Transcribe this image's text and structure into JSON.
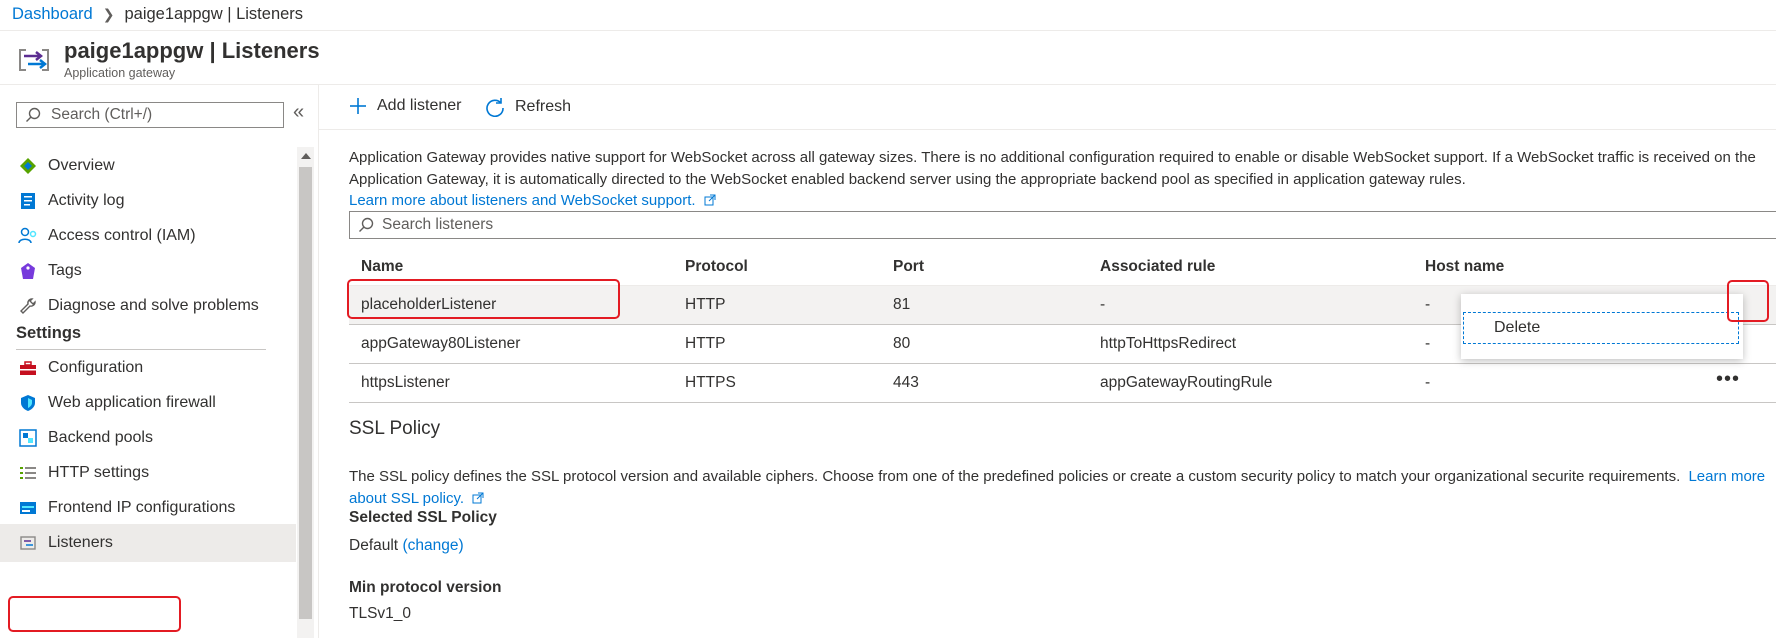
{
  "breadcrumb": {
    "root": "Dashboard",
    "current": "paige1appgw | Listeners"
  },
  "header": {
    "title": "paige1appgw | Listeners",
    "subtitle": "Application gateway"
  },
  "sidebar": {
    "search_placeholder": "Search (Ctrl+/)",
    "items": [
      {
        "label": "Overview",
        "icon": "overview-icon"
      },
      {
        "label": "Activity log",
        "icon": "activity-log-icon"
      },
      {
        "label": "Access control (IAM)",
        "icon": "iam-icon"
      },
      {
        "label": "Tags",
        "icon": "tag-icon"
      },
      {
        "label": "Diagnose and solve problems",
        "icon": "wrench-icon"
      }
    ],
    "settings_title": "Settings",
    "settings_items": [
      {
        "label": "Configuration",
        "icon": "toolbox-icon"
      },
      {
        "label": "Web application firewall",
        "icon": "shield-icon"
      },
      {
        "label": "Backend pools",
        "icon": "backend-pools-icon"
      },
      {
        "label": "HTTP settings",
        "icon": "list-settings-icon"
      },
      {
        "label": "Frontend IP configurations",
        "icon": "frontend-ip-icon"
      },
      {
        "label": "Listeners",
        "icon": "listener-icon",
        "active": true
      }
    ]
  },
  "toolbar": {
    "add_label": "Add listener",
    "refresh_label": "Refresh"
  },
  "info": {
    "text": "Application Gateway provides native support for WebSocket across all gateway sizes. There is no additional configuration required to enable or disable WebSocket support. If a WebSocket traffic is received on the Application Gateway, it is automatically directed to the WebSocket enabled backend server using the appropriate backend pool as specified in application gateway rules.",
    "link": "Learn more about listeners and WebSocket support."
  },
  "listeners": {
    "search_placeholder": "Search listeners",
    "columns": [
      "Name",
      "Protocol",
      "Port",
      "Associated rule",
      "Host name"
    ],
    "rows": [
      {
        "name": "placeholderListener",
        "protocol": "HTTP",
        "port": "81",
        "rule": "-",
        "host": "-"
      },
      {
        "name": "appGateway80Listener",
        "protocol": "HTTP",
        "port": "80",
        "rule": "httpToHttpsRedirect",
        "host": "-"
      },
      {
        "name": "httpsListener",
        "protocol": "HTTPS",
        "port": "443",
        "rule": "appGatewayRoutingRule",
        "host": "-"
      }
    ],
    "more_label": "•••"
  },
  "context_menu": {
    "delete_label": "Delete"
  },
  "ssl": {
    "title": "SSL Policy",
    "desc": "The SSL policy defines the SSL protocol version and available ciphers. Choose from one of the predefined policies or create a custom security policy to match your organizational securite requirements.",
    "link": "Learn more about SSL policy.",
    "selected_label": "Selected SSL Policy",
    "selected_value": "Default",
    "change_link": "(change)",
    "min_label": "Min protocol version",
    "min_value": "TLSv1_0"
  },
  "colors": {
    "accent": "#0078d4",
    "annotation": "#e31b23",
    "selected_row": "#f3f2f1"
  }
}
